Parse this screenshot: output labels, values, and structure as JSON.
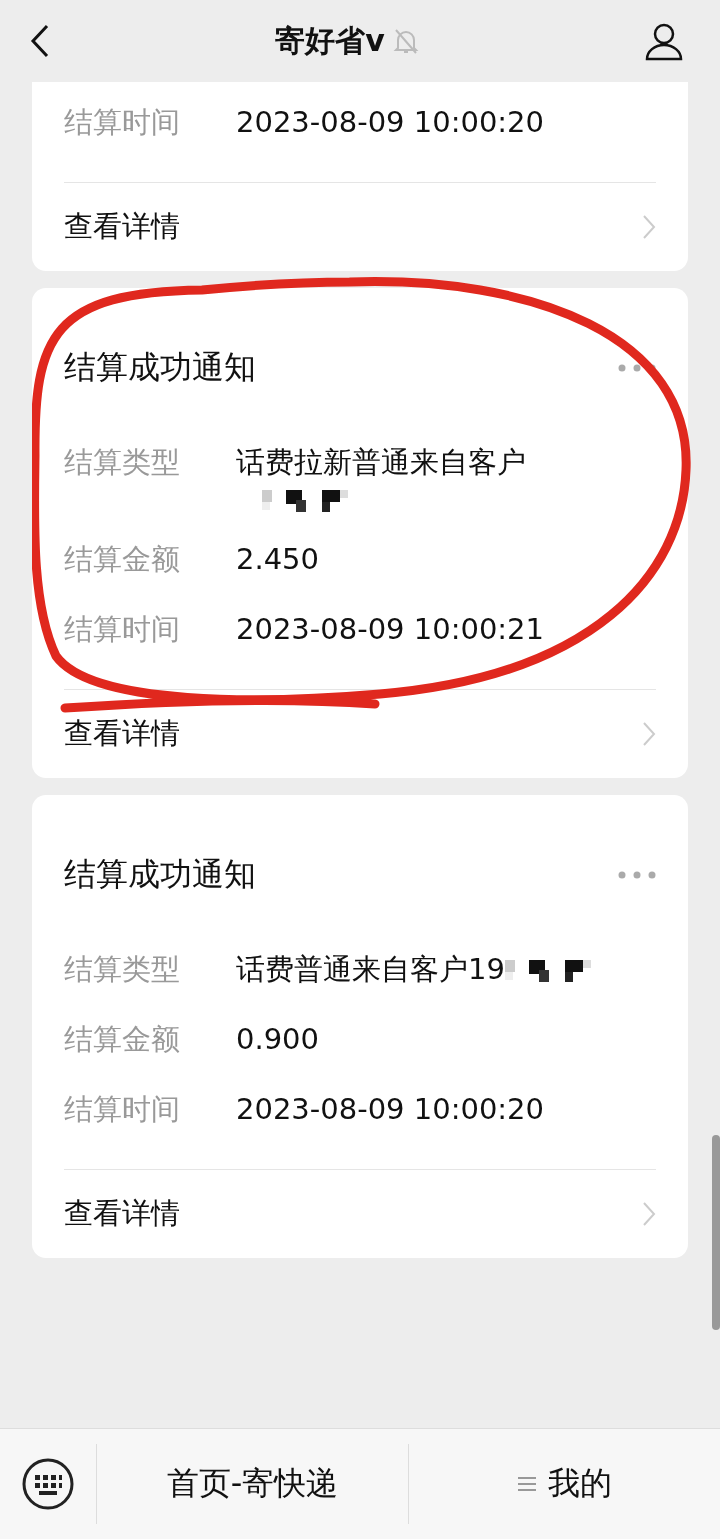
{
  "header": {
    "title": "寄好省v",
    "muted": true
  },
  "cards": [
    {
      "fields": [
        {
          "label": "结算时间",
          "value": "2023-08-09 10:00:20"
        }
      ],
      "link": "查看详情"
    },
    {
      "title": "结算成功通知",
      "more": true,
      "highlighted": true,
      "fields": [
        {
          "label": "结算类型",
          "value": "话费拉新普通来自客户",
          "redacted": true,
          "wrap": true
        },
        {
          "label": "结算金额",
          "value": "2.450"
        },
        {
          "label": "结算时间",
          "value": "2023-08-09 10:00:21"
        }
      ],
      "link": "查看详情"
    },
    {
      "title": "结算成功通知",
      "more": true,
      "fields": [
        {
          "label": "结算类型",
          "value": "话费普通来自客户19",
          "redacted": true
        },
        {
          "label": "结算金额",
          "value": "0.900"
        },
        {
          "label": "结算时间",
          "value": "2023-08-09 10:00:20"
        }
      ],
      "link": "查看详情"
    }
  ],
  "menu": [
    {
      "label": "首页-寄快递",
      "kind": "plain"
    },
    {
      "label": "我的",
      "kind": "submenu"
    }
  ]
}
